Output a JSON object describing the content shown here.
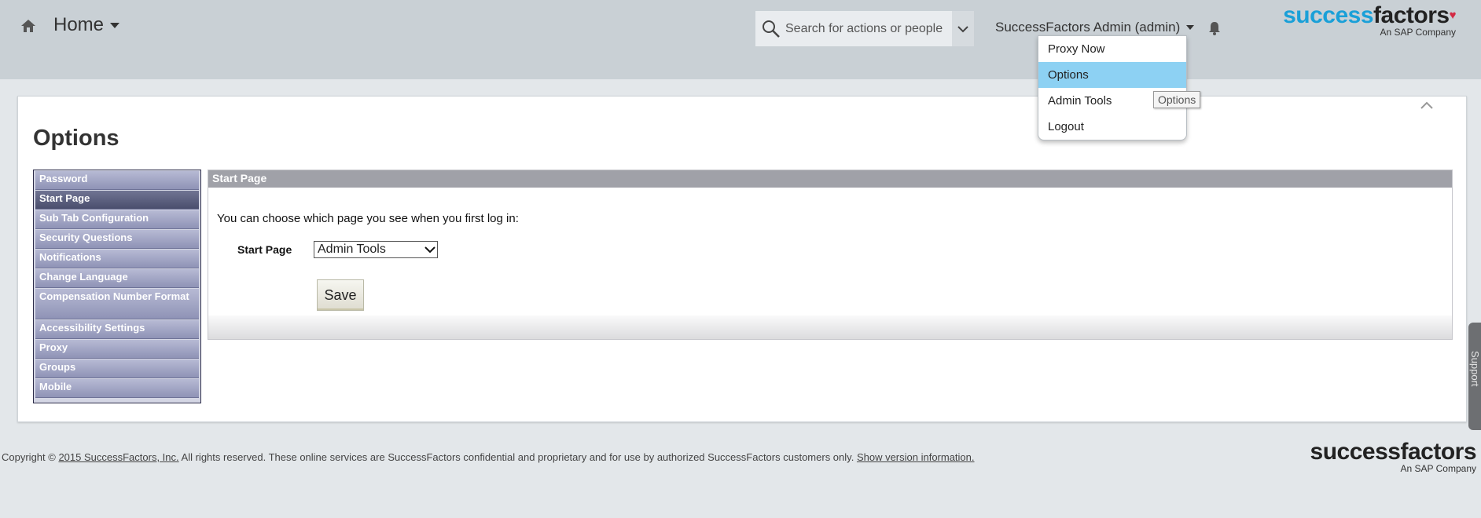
{
  "header": {
    "title": "Home",
    "search_placeholder": "Search for actions or people",
    "user_label": "SuccessFactors Admin (admin)",
    "logo_part1": "success",
    "logo_part2": "factors",
    "logo_tagline": "An SAP Company"
  },
  "user_dropdown": {
    "items": [
      {
        "label": "Proxy Now"
      },
      {
        "label": "Options"
      },
      {
        "label": "Admin Tools"
      },
      {
        "label": "Logout"
      }
    ],
    "tooltip": "Options"
  },
  "page": {
    "title": "Options"
  },
  "sidebar": {
    "items": [
      {
        "label": "Password"
      },
      {
        "label": "Start Page"
      },
      {
        "label": "Sub Tab Configuration"
      },
      {
        "label": "Security Questions"
      },
      {
        "label": "Notifications"
      },
      {
        "label": "Change Language"
      },
      {
        "label": "Compensation Number Format"
      },
      {
        "label": "Accessibility Settings"
      },
      {
        "label": "Proxy"
      },
      {
        "label": "Groups"
      },
      {
        "label": "Mobile"
      }
    ],
    "active": "Start Page"
  },
  "panel": {
    "header": "Start Page",
    "intro": "You can choose which page you see when you first log in:",
    "field_label": "Start Page",
    "field_value": "Admin Tools",
    "save_label": "Save"
  },
  "support_tab": "Support",
  "footer": {
    "copyright_prefix": "Copyright ©",
    "company_link": "2015 SuccessFactors, Inc.",
    "rights_text": "All rights reserved. These online services are SuccessFactors confidential and proprietary and for use by authorized SuccessFactors customers only.",
    "version_link": "Show version information.",
    "logo_text": "successfactors",
    "logo_tagline": "An SAP Company"
  },
  "colors": {
    "header_bg": "#c9d0d5",
    "dropdown_active": "#8dd1f3",
    "logo_blue": "#1aa0d8",
    "sidebar_active": "#4a4e6d"
  },
  "icons": [
    "home-icon",
    "search-icon",
    "chevron-down-icon",
    "caret-down-icon",
    "bell-icon",
    "chevron-up-icon"
  ]
}
